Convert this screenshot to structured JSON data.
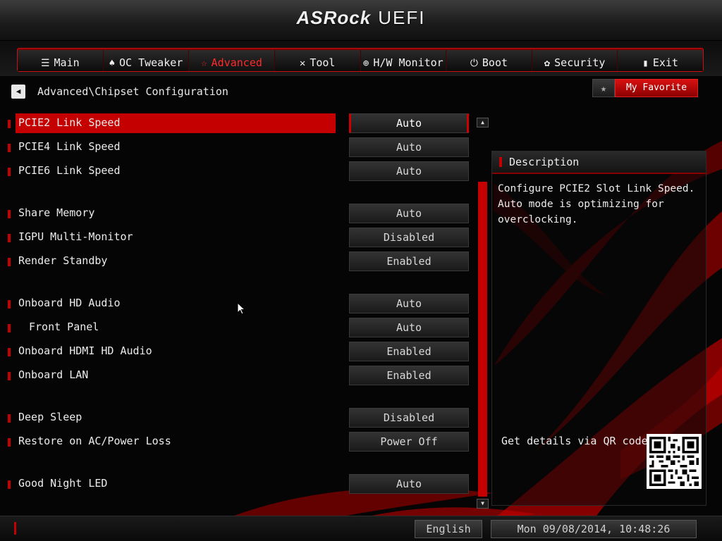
{
  "header": {
    "brand": "ASRock",
    "product": "UEFI"
  },
  "nav": {
    "tabs": [
      {
        "label": "Main",
        "icon": "list-icon"
      },
      {
        "label": "OC Tweaker",
        "icon": "rocket-icon"
      },
      {
        "label": "Advanced",
        "icon": "star-icon",
        "active": true
      },
      {
        "label": "Tool",
        "icon": "tools-icon"
      },
      {
        "label": "H/W Monitor",
        "icon": "monitor-icon"
      },
      {
        "label": "Boot",
        "icon": "power-icon"
      },
      {
        "label": "Security",
        "icon": "shield-icon"
      },
      {
        "label": "Exit",
        "icon": "exit-door-icon"
      }
    ]
  },
  "breadcrumb": "Advanced\\Chipset Configuration",
  "favorite": {
    "label": "My Favorite"
  },
  "settings": [
    {
      "label": "PCIE2 Link Speed",
      "value": "Auto"
    },
    {
      "label": "PCIE4 Link Speed",
      "value": "Auto"
    },
    {
      "label": "PCIE6 Link Speed",
      "value": "Auto"
    },
    {
      "label": "Share Memory",
      "value": "Auto"
    },
    {
      "label": "IGPU Multi-Monitor",
      "value": "Disabled"
    },
    {
      "label": "Render Standby",
      "value": "Enabled"
    },
    {
      "label": "Onboard HD Audio",
      "value": "Auto"
    },
    {
      "label": "Front Panel",
      "value": "Auto"
    },
    {
      "label": "Onboard HDMI HD Audio",
      "value": "Enabled"
    },
    {
      "label": "Onboard LAN",
      "value": "Enabled"
    },
    {
      "label": "Deep Sleep",
      "value": "Disabled"
    },
    {
      "label": "Restore on AC/Power Loss",
      "value": "Power Off"
    },
    {
      "label": "Good Night LED",
      "value": "Auto"
    }
  ],
  "description": {
    "title": "Description",
    "text": "Configure PCIE2 Slot Link Speed. Auto mode is optimizing for overclocking."
  },
  "qr": {
    "label": "Get details via QR code"
  },
  "footer": {
    "language": "English",
    "datetime": "Mon 09/08/2014, 10:48:26"
  },
  "colors": {
    "accent": "#c40000",
    "background": "#050505"
  }
}
